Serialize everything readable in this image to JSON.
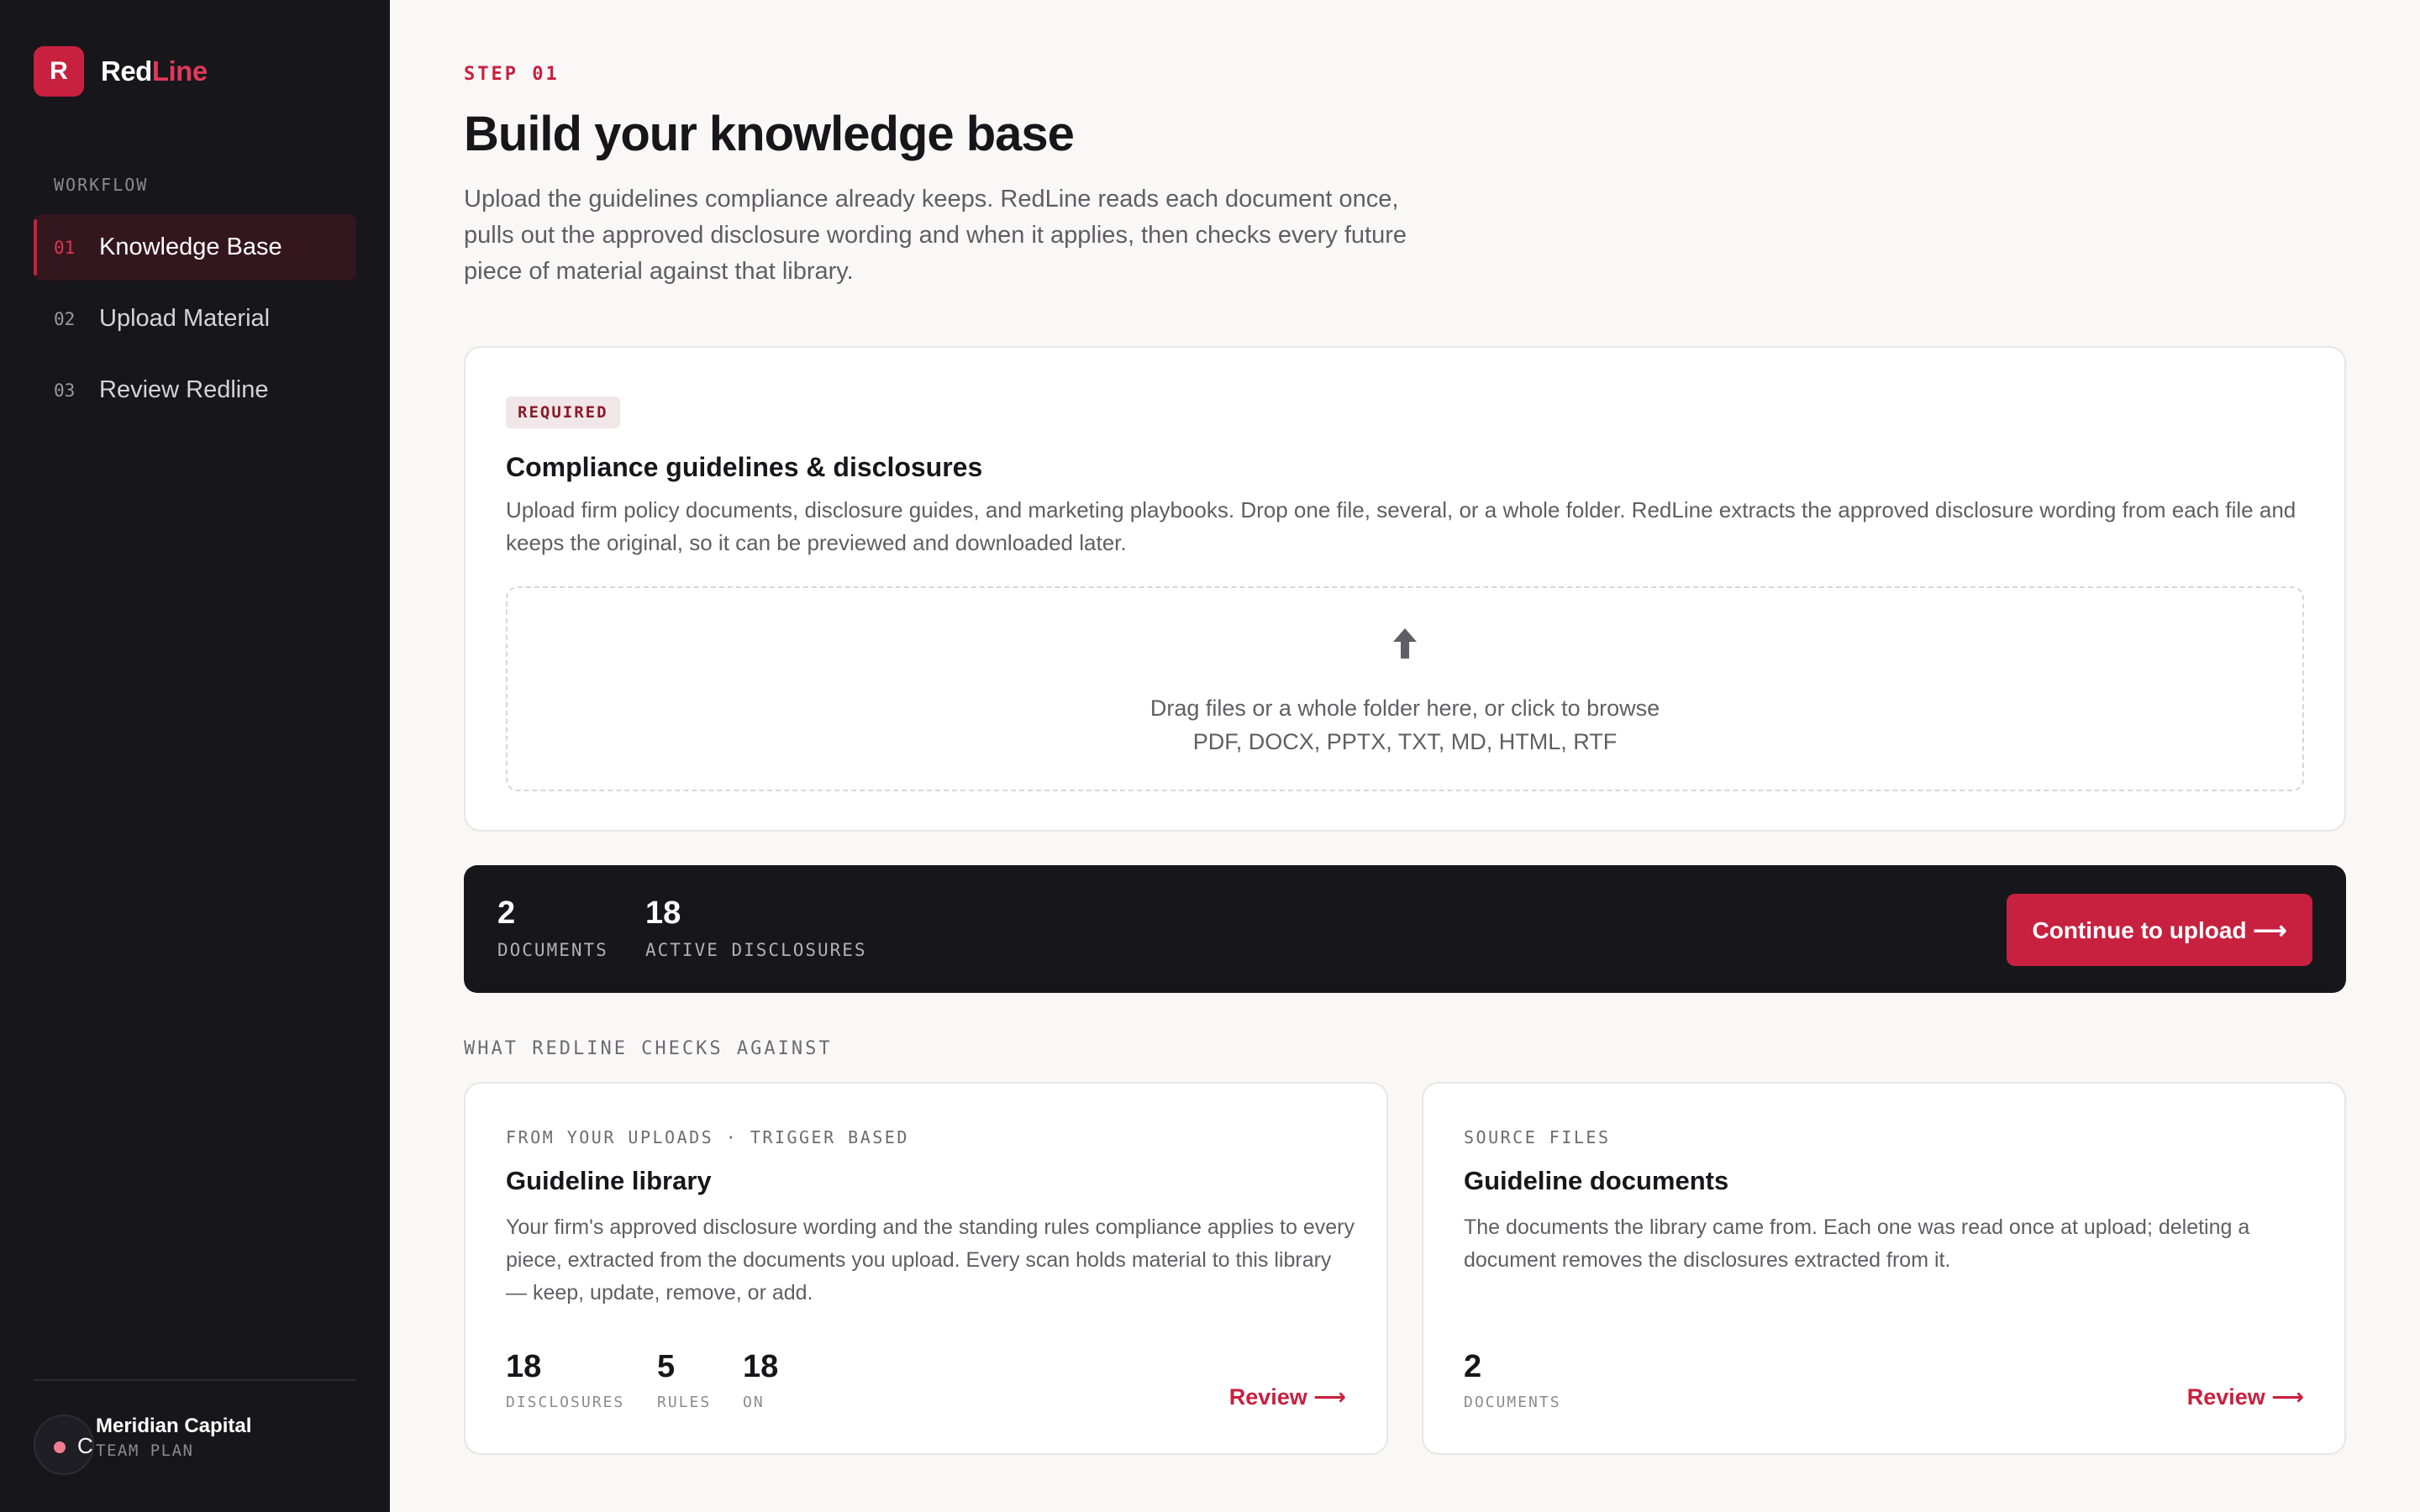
{
  "sidebar": {
    "brand": {
      "logo_letter": "R",
      "name_primary": "Red",
      "name_accent": "Line"
    },
    "section_label": "WORKFLOW",
    "items": [
      {
        "num": "01",
        "label": "Knowledge Base",
        "active": true
      },
      {
        "num": "02",
        "label": "Upload Material",
        "active": false
      },
      {
        "num": "03",
        "label": "Review Redline",
        "active": false
      }
    ],
    "org": {
      "avatar_letter": "C",
      "name": "Meridian Capital",
      "plan": "TEAM PLAN"
    }
  },
  "header": {
    "step": "STEP 01",
    "title": "Build your knowledge base",
    "intro": "Upload the guidelines compliance already keeps. RedLine reads each document once, pulls out the approved disclosure wording and when it applies, then checks every future piece of material against that library."
  },
  "upload_card": {
    "badge": "REQUIRED",
    "title": "Compliance guidelines & disclosures",
    "description": "Upload firm policy documents, disclosure guides, and marketing playbooks. Drop one file, several, or a whole folder. RedLine extracts the approved disclosure wording from each file and keeps the original, so it can be previewed and downloaded later.",
    "dropzone": {
      "icon": "upload-arrow-icon",
      "main_text": "Drag files or a whole folder here, or click to browse",
      "formats": "PDF, DOCX, PPTX, TXT, MD, HTML, RTF"
    }
  },
  "stats_bar": {
    "documents": {
      "value": "2",
      "label": "DOCUMENTS"
    },
    "disclosures": {
      "value": "18",
      "label": "ACTIVE DISCLOSURES"
    },
    "cta_label": "Continue to upload ⟶"
  },
  "checks": {
    "section_label": "WHAT REDLINE CHECKS AGAINST",
    "library": {
      "eyebrow": "FROM YOUR UPLOADS · TRIGGER BASED",
      "title": "Guideline library",
      "description": "Your firm's approved disclosure wording and the standing rules compliance applies to every piece, extracted from the documents you upload. Every scan holds material to this library — keep, update, remove, or add.",
      "stats": [
        {
          "value": "18",
          "label": "DISCLOSURES"
        },
        {
          "value": "5",
          "label": "RULES"
        },
        {
          "value": "18",
          "label": "ON"
        }
      ],
      "link": "Review ⟶"
    },
    "documents": {
      "eyebrow": "SOURCE FILES",
      "title": "Guideline documents",
      "description": "The documents the library came from. Each one was read once at upload; deleting a document removes the disclosures extracted from it.",
      "stats": [
        {
          "value": "2",
          "label": "DOCUMENTS"
        }
      ],
      "link": "Review ⟶"
    }
  },
  "colors": {
    "accent": "#c8203f",
    "sidebar_bg": "#17161b",
    "page_bg": "#f9f8f7"
  }
}
